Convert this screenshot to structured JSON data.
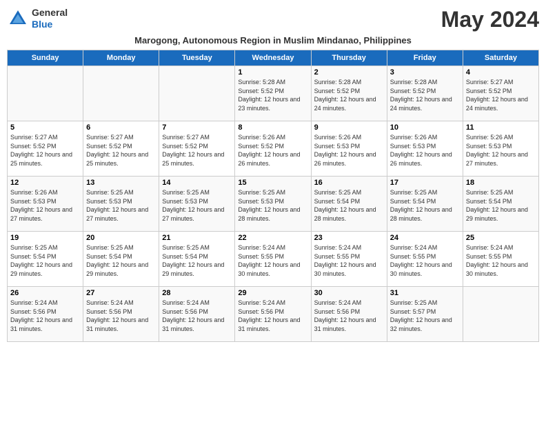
{
  "header": {
    "logo_general": "General",
    "logo_blue": "Blue",
    "month_title": "May 2024",
    "subtitle": "Marogong, Autonomous Region in Muslim Mindanao, Philippines"
  },
  "days_of_week": [
    "Sunday",
    "Monday",
    "Tuesday",
    "Wednesday",
    "Thursday",
    "Friday",
    "Saturday"
  ],
  "weeks": [
    {
      "days": [
        {
          "num": "",
          "sunrise": "",
          "sunset": "",
          "daylight": "",
          "empty": true
        },
        {
          "num": "",
          "sunrise": "",
          "sunset": "",
          "daylight": "",
          "empty": true
        },
        {
          "num": "",
          "sunrise": "",
          "sunset": "",
          "daylight": "",
          "empty": true
        },
        {
          "num": "1",
          "sunrise": "Sunrise: 5:28 AM",
          "sunset": "Sunset: 5:52 PM",
          "daylight": "Daylight: 12 hours and 23 minutes.",
          "empty": false
        },
        {
          "num": "2",
          "sunrise": "Sunrise: 5:28 AM",
          "sunset": "Sunset: 5:52 PM",
          "daylight": "Daylight: 12 hours and 24 minutes.",
          "empty": false
        },
        {
          "num": "3",
          "sunrise": "Sunrise: 5:28 AM",
          "sunset": "Sunset: 5:52 PM",
          "daylight": "Daylight: 12 hours and 24 minutes.",
          "empty": false
        },
        {
          "num": "4",
          "sunrise": "Sunrise: 5:27 AM",
          "sunset": "Sunset: 5:52 PM",
          "daylight": "Daylight: 12 hours and 24 minutes.",
          "empty": false
        }
      ]
    },
    {
      "days": [
        {
          "num": "5",
          "sunrise": "Sunrise: 5:27 AM",
          "sunset": "Sunset: 5:52 PM",
          "daylight": "Daylight: 12 hours and 25 minutes.",
          "empty": false
        },
        {
          "num": "6",
          "sunrise": "Sunrise: 5:27 AM",
          "sunset": "Sunset: 5:52 PM",
          "daylight": "Daylight: 12 hours and 25 minutes.",
          "empty": false
        },
        {
          "num": "7",
          "sunrise": "Sunrise: 5:27 AM",
          "sunset": "Sunset: 5:52 PM",
          "daylight": "Daylight: 12 hours and 25 minutes.",
          "empty": false
        },
        {
          "num": "8",
          "sunrise": "Sunrise: 5:26 AM",
          "sunset": "Sunset: 5:52 PM",
          "daylight": "Daylight: 12 hours and 26 minutes.",
          "empty": false
        },
        {
          "num": "9",
          "sunrise": "Sunrise: 5:26 AM",
          "sunset": "Sunset: 5:53 PM",
          "daylight": "Daylight: 12 hours and 26 minutes.",
          "empty": false
        },
        {
          "num": "10",
          "sunrise": "Sunrise: 5:26 AM",
          "sunset": "Sunset: 5:53 PM",
          "daylight": "Daylight: 12 hours and 26 minutes.",
          "empty": false
        },
        {
          "num": "11",
          "sunrise": "Sunrise: 5:26 AM",
          "sunset": "Sunset: 5:53 PM",
          "daylight": "Daylight: 12 hours and 27 minutes.",
          "empty": false
        }
      ]
    },
    {
      "days": [
        {
          "num": "12",
          "sunrise": "Sunrise: 5:26 AM",
          "sunset": "Sunset: 5:53 PM",
          "daylight": "Daylight: 12 hours and 27 minutes.",
          "empty": false
        },
        {
          "num": "13",
          "sunrise": "Sunrise: 5:25 AM",
          "sunset": "Sunset: 5:53 PM",
          "daylight": "Daylight: 12 hours and 27 minutes.",
          "empty": false
        },
        {
          "num": "14",
          "sunrise": "Sunrise: 5:25 AM",
          "sunset": "Sunset: 5:53 PM",
          "daylight": "Daylight: 12 hours and 27 minutes.",
          "empty": false
        },
        {
          "num": "15",
          "sunrise": "Sunrise: 5:25 AM",
          "sunset": "Sunset: 5:53 PM",
          "daylight": "Daylight: 12 hours and 28 minutes.",
          "empty": false
        },
        {
          "num": "16",
          "sunrise": "Sunrise: 5:25 AM",
          "sunset": "Sunset: 5:54 PM",
          "daylight": "Daylight: 12 hours and 28 minutes.",
          "empty": false
        },
        {
          "num": "17",
          "sunrise": "Sunrise: 5:25 AM",
          "sunset": "Sunset: 5:54 PM",
          "daylight": "Daylight: 12 hours and 28 minutes.",
          "empty": false
        },
        {
          "num": "18",
          "sunrise": "Sunrise: 5:25 AM",
          "sunset": "Sunset: 5:54 PM",
          "daylight": "Daylight: 12 hours and 29 minutes.",
          "empty": false
        }
      ]
    },
    {
      "days": [
        {
          "num": "19",
          "sunrise": "Sunrise: 5:25 AM",
          "sunset": "Sunset: 5:54 PM",
          "daylight": "Daylight: 12 hours and 29 minutes.",
          "empty": false
        },
        {
          "num": "20",
          "sunrise": "Sunrise: 5:25 AM",
          "sunset": "Sunset: 5:54 PM",
          "daylight": "Daylight: 12 hours and 29 minutes.",
          "empty": false
        },
        {
          "num": "21",
          "sunrise": "Sunrise: 5:25 AM",
          "sunset": "Sunset: 5:54 PM",
          "daylight": "Daylight: 12 hours and 29 minutes.",
          "empty": false
        },
        {
          "num": "22",
          "sunrise": "Sunrise: 5:24 AM",
          "sunset": "Sunset: 5:55 PM",
          "daylight": "Daylight: 12 hours and 30 minutes.",
          "empty": false
        },
        {
          "num": "23",
          "sunrise": "Sunrise: 5:24 AM",
          "sunset": "Sunset: 5:55 PM",
          "daylight": "Daylight: 12 hours and 30 minutes.",
          "empty": false
        },
        {
          "num": "24",
          "sunrise": "Sunrise: 5:24 AM",
          "sunset": "Sunset: 5:55 PM",
          "daylight": "Daylight: 12 hours and 30 minutes.",
          "empty": false
        },
        {
          "num": "25",
          "sunrise": "Sunrise: 5:24 AM",
          "sunset": "Sunset: 5:55 PM",
          "daylight": "Daylight: 12 hours and 30 minutes.",
          "empty": false
        }
      ]
    },
    {
      "days": [
        {
          "num": "26",
          "sunrise": "Sunrise: 5:24 AM",
          "sunset": "Sunset: 5:56 PM",
          "daylight": "Daylight: 12 hours and 31 minutes.",
          "empty": false
        },
        {
          "num": "27",
          "sunrise": "Sunrise: 5:24 AM",
          "sunset": "Sunset: 5:56 PM",
          "daylight": "Daylight: 12 hours and 31 minutes.",
          "empty": false
        },
        {
          "num": "28",
          "sunrise": "Sunrise: 5:24 AM",
          "sunset": "Sunset: 5:56 PM",
          "daylight": "Daylight: 12 hours and 31 minutes.",
          "empty": false
        },
        {
          "num": "29",
          "sunrise": "Sunrise: 5:24 AM",
          "sunset": "Sunset: 5:56 PM",
          "daylight": "Daylight: 12 hours and 31 minutes.",
          "empty": false
        },
        {
          "num": "30",
          "sunrise": "Sunrise: 5:24 AM",
          "sunset": "Sunset: 5:56 PM",
          "daylight": "Daylight: 12 hours and 31 minutes.",
          "empty": false
        },
        {
          "num": "31",
          "sunrise": "Sunrise: 5:25 AM",
          "sunset": "Sunset: 5:57 PM",
          "daylight": "Daylight: 12 hours and 32 minutes.",
          "empty": false
        },
        {
          "num": "",
          "sunrise": "",
          "sunset": "",
          "daylight": "",
          "empty": true
        }
      ]
    }
  ]
}
